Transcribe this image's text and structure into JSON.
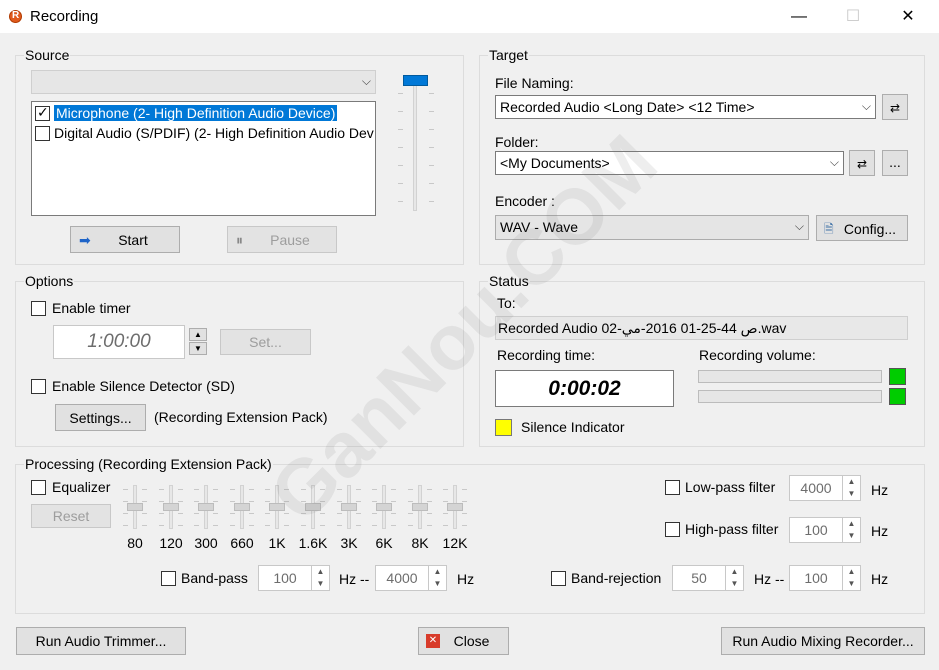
{
  "window": {
    "title": "Recording",
    "minimize": "—",
    "maximize": "☐",
    "close": "✕"
  },
  "source": {
    "group_label": "Source",
    "devices": [
      {
        "label": "Microphone (2- High Definition Audio Device)",
        "checked": true
      },
      {
        "label": "Digital Audio (S/PDIF) (2- High Definition Audio Device",
        "checked": false
      }
    ],
    "start_label": "Start",
    "pause_label": "Pause"
  },
  "target": {
    "group_label": "Target",
    "file_naming_label": "File Naming:",
    "file_naming_value": "Recorded Audio <Long Date> <12 Time>",
    "folder_label": "Folder:",
    "folder_value": "<My Documents>",
    "browse_label": "...",
    "encoder_label": "Encoder :",
    "encoder_value": "WAV - Wave",
    "config_label": "Config..."
  },
  "options": {
    "group_label": "Options",
    "enable_timer_label": "Enable timer",
    "timer_value": "1:00:00",
    "set_label": "Set...",
    "silence_detector_label": "Enable Silence Detector (SD)",
    "settings_label": "Settings...",
    "extension_pack_note": "(Recording Extension Pack)"
  },
  "status": {
    "group_label": "Status",
    "to_label": "To:",
    "to_value": "Recorded Audio 02-ص 44-25-01 2016-مي.wav",
    "recording_time_label": "Recording time:",
    "recording_time_value": "0:00:02",
    "recording_volume_label": "Recording volume:",
    "silence_indicator_label": "Silence Indicator",
    "silence_color": "#ffff00",
    "volume_led_color": "#00cc00"
  },
  "processing": {
    "group_label": "Processing (Recording Extension Pack)",
    "equalizer_label": "Equalizer",
    "reset_label": "Reset",
    "eq_bands": [
      "80",
      "120",
      "300",
      "660",
      "1K",
      "1.6K",
      "3K",
      "6K",
      "8K",
      "12K"
    ],
    "bandpass_label": "Band-pass",
    "bandpass_low": "100",
    "bandpass_high": "4000",
    "hz_dash": "Hz --",
    "hz": "Hz",
    "lowpass_label": "Low-pass filter",
    "lowpass_value": "4000",
    "highpass_label": "High-pass filter",
    "highpass_value": "100",
    "bandrejection_label": "Band-rejection",
    "bandrejection_low": "50",
    "bandrejection_high": "100"
  },
  "footer": {
    "trimmer_label": "Run Audio Trimmer...",
    "close_label": "Close",
    "mixing_label": "Run Audio Mixing Recorder..."
  },
  "watermark": "GanNou.COM"
}
